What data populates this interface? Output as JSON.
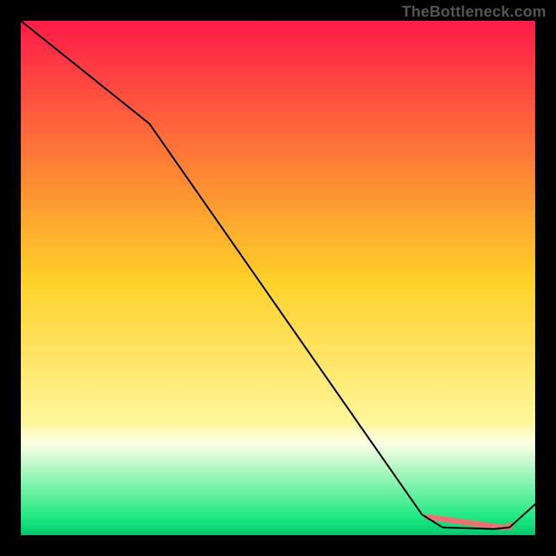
{
  "watermark": "TheBottleneck.com",
  "chart_data": {
    "type": "line",
    "title": "",
    "xlabel": "",
    "ylabel": "",
    "xlim": [
      0,
      100
    ],
    "ylim": [
      0,
      100
    ],
    "grid": false,
    "gradient": {
      "stops": [
        {
          "offset": 0.0,
          "color": "#ff1b49"
        },
        {
          "offset": 0.5,
          "color": "#ffcf27"
        },
        {
          "offset": 0.78,
          "color": "#fff799"
        },
        {
          "offset": 0.82,
          "color": "#ffffe6"
        },
        {
          "offset": 0.97,
          "color": "#17e87f"
        },
        {
          "offset": 1.0,
          "color": "#00c86a"
        }
      ]
    },
    "series": [
      {
        "name": "bottleneck-curve",
        "x": [
          0,
          25,
          78,
          82,
          92,
          95,
          100
        ],
        "y": [
          100,
          80,
          4,
          1.5,
          1.2,
          1.5,
          6
        ],
        "color": "#000000",
        "width": 2.5
      }
    ],
    "annotations": [
      {
        "name": "min-marker-segment",
        "type": "thick-segment",
        "x0": 79,
        "y0": 3.5,
        "x1": 94,
        "y1": 1.4,
        "color": "#f07070",
        "width": 8
      },
      {
        "name": "min-marker-dot",
        "type": "dot",
        "x": 95,
        "y": 1.7,
        "r": 5.5,
        "color": "#f07070"
      }
    ]
  }
}
